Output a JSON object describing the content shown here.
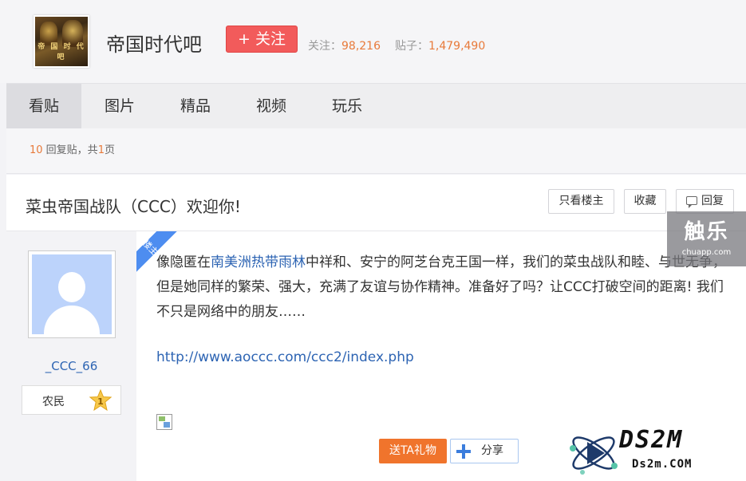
{
  "forum": {
    "name": "帝国时代吧",
    "logo_text": "帝 国 时 代 吧",
    "follow_label": "+ 关注",
    "followers_label": "关注：",
    "followers_count": "98,216",
    "posts_label": "贴子：",
    "posts_count": "1,479,490"
  },
  "tabs": [
    {
      "label": "看贴"
    },
    {
      "label": "图片"
    },
    {
      "label": "精品"
    },
    {
      "label": "视频"
    },
    {
      "label": "玩乐"
    }
  ],
  "thread": {
    "reply_count": "10",
    "reply_suffix": " 回复贴，共",
    "page_count": "1",
    "page_suffix": "页",
    "title": "菜虫帝国战队（CCC）欢迎你!",
    "buttons": {
      "only_op": "只看楼主",
      "favorite": "收藏",
      "reply": "回复"
    }
  },
  "post": {
    "badge": "楼主",
    "author": "_CCC_66",
    "level_name": "农民",
    "level_num": "1",
    "text_before_link": "像隐匿在",
    "text_link": "南美洲热带雨林",
    "text_after_link": "中祥和、安宁的阿芝台克王国一样，我们的菜虫战队和睦、与世无争，但是她同样的繁荣、强大，充满了友谊与协作精神。准备好了吗？让CCC打破空间的距离! 我们不只是网络中的朋友……",
    "url": "http://www.aoccc.com/ccc2/index.php",
    "gift_label": "送TA礼物",
    "share_label": "分享"
  },
  "watermarks": {
    "chule_big": "触乐",
    "chule_small": "chuapp.com",
    "ds2m_big": "DS2M",
    "ds2m_small": "Ds2m.COM"
  },
  "colors": {
    "accent_orange": "#e87a3a",
    "follow_red": "#f25b5b",
    "link_blue": "#2d64b3"
  }
}
